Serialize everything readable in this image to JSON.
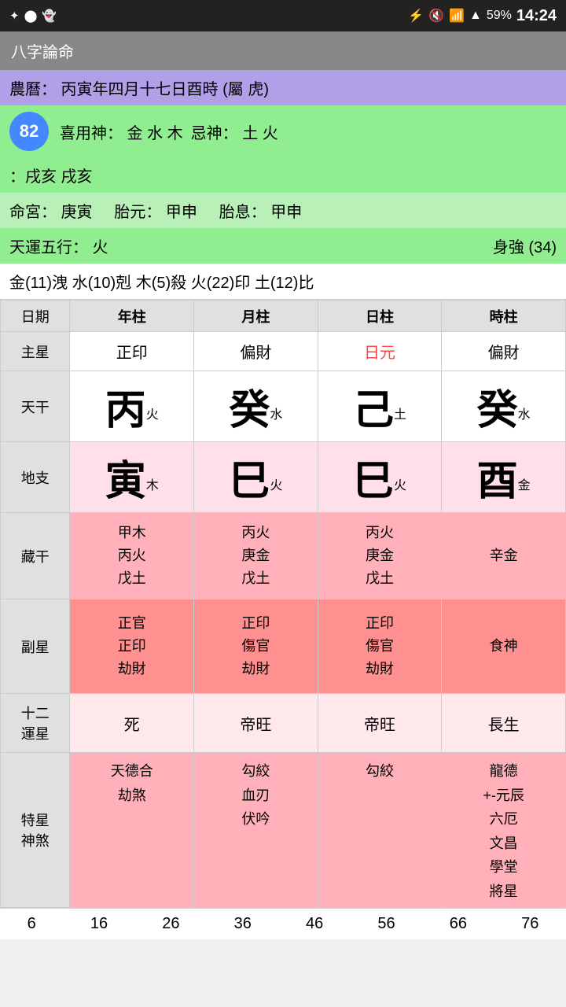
{
  "statusBar": {
    "battery": "59%",
    "time": "14:24",
    "icons": [
      "bluetooth",
      "mute",
      "wifi",
      "signal"
    ]
  },
  "titleBar": {
    "title": "八字論命"
  },
  "info": {
    "lunarCalendar": "農曆： 丙寅年四月十七日酉時 (屬 虎)",
    "xiyong": "喜用神： 金 水 木",
    "jiShen": "忌神： 土 火",
    "score": "82",
    "nayin": "：戌亥 戌亥",
    "mingGong": "命宮： 庚寅",
    "taiYuan": "胎元： 甲申",
    "taiXi": "胎息： 甲申",
    "tianYun": "天運五行： 火",
    "shenQiang": "身強 (34)",
    "elements": "金(11)洩  水(10)剋  木(5)殺  火(22)印  土(12)比"
  },
  "table": {
    "headers": [
      "日期",
      "年柱",
      "月柱",
      "日柱",
      "時柱"
    ],
    "mainStarLabel": "主星",
    "mainStars": [
      "正印",
      "偏財",
      "日元",
      "偏財"
    ],
    "tianganLabel": "天干",
    "tiangan": [
      {
        "char": "丙",
        "sub": "火"
      },
      {
        "char": "癸",
        "sub": "水"
      },
      {
        "char": "己",
        "sub": "土"
      },
      {
        "char": "癸",
        "sub": "水"
      }
    ],
    "dizhiLabel": "地支",
    "dizhi": [
      {
        "char": "寅",
        "sub": "木"
      },
      {
        "char": "巳",
        "sub": "火"
      },
      {
        "char": "巳",
        "sub": "火"
      },
      {
        "char": "酉",
        "sub": "金"
      }
    ],
    "cangganLabel": "藏干",
    "canggan": [
      [
        "甲木",
        "丙火",
        "戊土"
      ],
      [
        "丙火",
        "庚金",
        "戊土"
      ],
      [
        "丙火",
        "庚金",
        "戊土"
      ],
      [
        "辛金"
      ]
    ],
    "fuxingLabel": "副星",
    "fuxing": [
      [
        "正官",
        "正印",
        "劫財"
      ],
      [
        "正印",
        "傷官",
        "劫財"
      ],
      [
        "正印",
        "傷官",
        "劫財"
      ],
      [
        "食神"
      ]
    ],
    "twelveStarsLabel": "十二\n運星",
    "twelveStars": [
      "死",
      "帝旺",
      "帝旺",
      "長生"
    ],
    "specialLabel": "特星\n神煞",
    "special": [
      [
        "天德合",
        "劫煞"
      ],
      [
        "勾絞",
        "血刃",
        "伏吟"
      ],
      [
        "勾絞"
      ],
      [
        "龍德",
        "+-元辰",
        "六厄",
        "文昌",
        "學堂",
        "將星"
      ]
    ]
  },
  "bottomNumbers": [
    "6",
    "16",
    "26",
    "36",
    "46",
    "56",
    "66",
    "76"
  ]
}
